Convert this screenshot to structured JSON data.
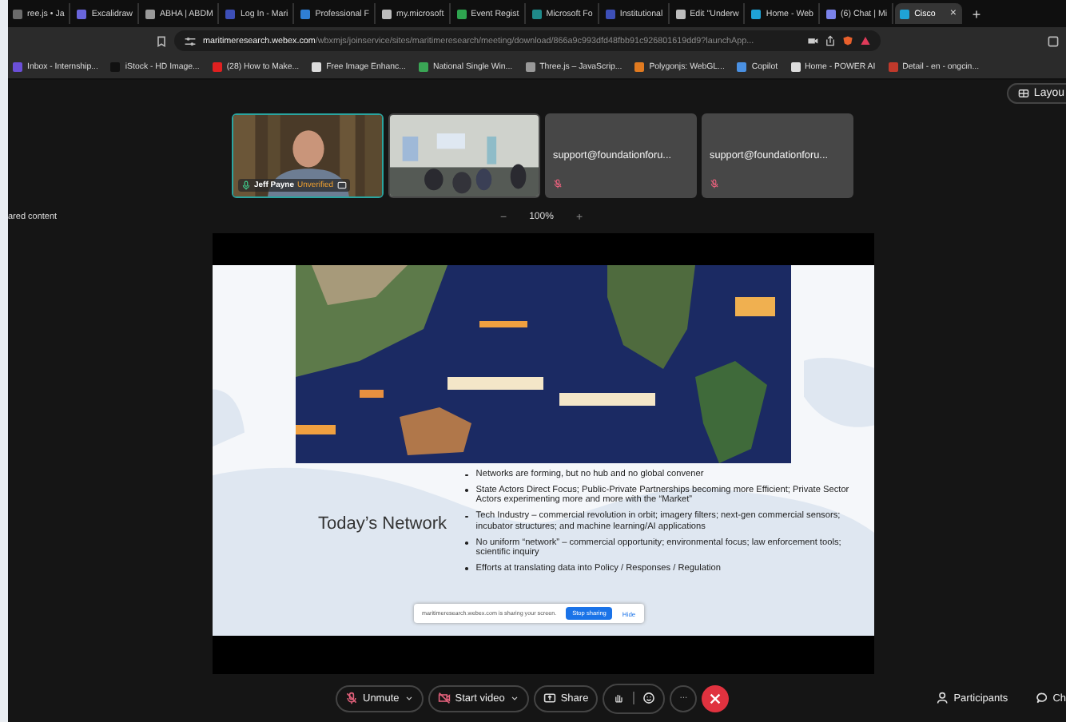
{
  "browser": {
    "tabs": [
      {
        "label": "ree.js • Ja",
        "color": "#6b6b6b",
        "selected": false
      },
      {
        "label": "Excalidraw",
        "color": "#6965db",
        "selected": false
      },
      {
        "label": "ABHA | ABDM",
        "color": "#9a9a9a",
        "selected": false
      },
      {
        "label": "Log In - Mari",
        "color": "#3d4fb8",
        "selected": false
      },
      {
        "label": "Professional F",
        "color": "#2f7fd6",
        "selected": false
      },
      {
        "label": "my.microsoft",
        "color": "#bdbdbd",
        "selected": false
      },
      {
        "label": "Event Regist",
        "color": "#2ea44f",
        "selected": false
      },
      {
        "label": "Microsoft Fo",
        "color": "#1f8a8a",
        "selected": false
      },
      {
        "label": "Institutional",
        "color": "#3d4fb8",
        "selected": false
      },
      {
        "label": "Edit \"Underw",
        "color": "#bdbdbd",
        "selected": false
      },
      {
        "label": "Home - Web",
        "color": "#1fa3d6",
        "selected": false
      },
      {
        "label": "(6) Chat | Mi",
        "color": "#7b83eb",
        "selected": false
      },
      {
        "label": "Cisco",
        "color": "#1fa3d6",
        "selected": true
      }
    ],
    "new_tab": "+",
    "close_tab": "×",
    "address": {
      "host": "maritimeresearch.webex.com",
      "path": "/wbxmjs/joinservice/sites/maritimeresearch/meeting/download/866a9c993dfd48fbb91c926801619dd9?launchApp..."
    },
    "bookmarks": [
      {
        "label": "Inbox - Internship...",
        "color": "#6b4fd8"
      },
      {
        "label": "iStock - HD Image...",
        "color": "#111111"
      },
      {
        "label": "(28) How to Make...",
        "color": "#e02020"
      },
      {
        "label": "Free Image Enhanc...",
        "color": "#dddddd"
      },
      {
        "label": "National Single Win...",
        "color": "#3aa655"
      },
      {
        "label": "Three.js – JavaScrip...",
        "color": "#999999"
      },
      {
        "label": "Polygonjs: WebGL...",
        "color": "#e07a20"
      },
      {
        "label": "Copilot",
        "color": "#4a90e2"
      },
      {
        "label": "Home - POWER AI",
        "color": "#dddddd"
      },
      {
        "label": "Detail - en - ongcin...",
        "color": "#c0392b"
      }
    ]
  },
  "meeting": {
    "layout_button": "Layou",
    "participants": [
      {
        "kind": "video",
        "name": "Jeff Payne",
        "status": "Unverified",
        "muted": false,
        "selected": true
      },
      {
        "kind": "room",
        "selected": false
      },
      {
        "kind": "audio",
        "name": "support@foundationforu...",
        "muted": true,
        "selected": false
      },
      {
        "kind": "audio",
        "name": "support@foundationforu...",
        "muted": true,
        "selected": false
      }
    ],
    "shared_content_label": "ared content",
    "zoom": {
      "minus": "−",
      "value": "100%",
      "plus": "+"
    },
    "slide": {
      "title": "Today’s Network",
      "bullets": [
        "Networks are forming, but no hub and no global convener",
        "State Actors Direct Focus; Public-Private Partnerships becoming more Efficient; Private Sector Actors experimenting more and more with the “Market”",
        "Tech Industry – commercial revolution in orbit; imagery filters; next-gen commercial sensors; incubator structures; and machine learning/AI applications",
        "No uniform “network” – commercial opportunity; environmental focus; law enforcement tools; scientific inquiry",
        "Efforts at translating data into Policy / Responses / Regulation"
      ]
    },
    "share_notice": {
      "message": "maritimeresearch.webex.com is sharing your screen.",
      "stop_button": "Stop sharing",
      "hide_link": "Hide"
    },
    "toolbar": {
      "unmute": "Unmute",
      "start_video": "Start video",
      "share": "Share",
      "more": "···",
      "participants": "Participants",
      "chat": "Ch"
    }
  }
}
